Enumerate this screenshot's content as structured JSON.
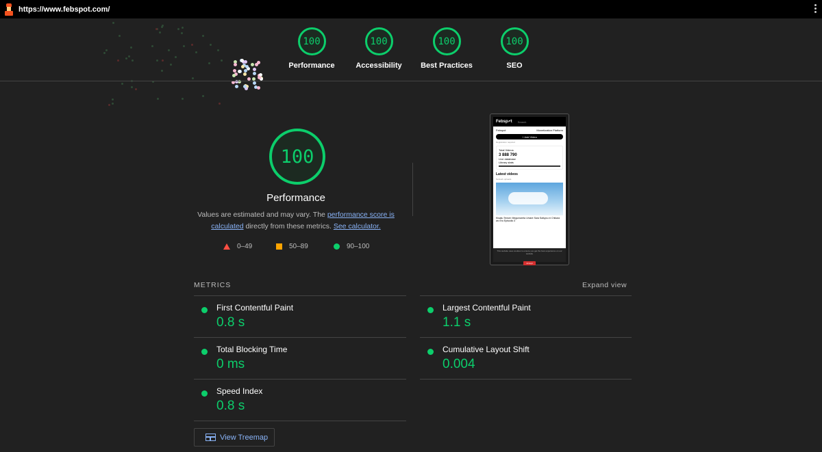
{
  "browser": {
    "url": "https://www.febspot.com/"
  },
  "gauges": [
    {
      "score": "100",
      "label": "Performance"
    },
    {
      "score": "100",
      "label": "Accessibility"
    },
    {
      "score": "100",
      "label": "Best Practices"
    },
    {
      "score": "100",
      "label": "SEO"
    }
  ],
  "performance": {
    "score": "100",
    "title": "Performance",
    "desc_pre": "Values are estimated and may vary. The ",
    "desc_link1": "performance score is calculated",
    "desc_mid": " directly from these metrics. ",
    "desc_link2": "See calculator.",
    "legend": [
      {
        "shape": "triangle",
        "range": "0–49",
        "color": "#ff4e42"
      },
      {
        "shape": "square",
        "range": "50–89",
        "color": "#ffa400"
      },
      {
        "shape": "circle",
        "range": "90–100",
        "color": "#0cce6b"
      }
    ]
  },
  "screenshot": {
    "brand": "Febsp🗲t",
    "search": "Search",
    "row_left": "Febspot",
    "row_right": "Monetization Platform",
    "add_button": "+ Add Video",
    "registration": "Registration required",
    "total_label": "Total Videos",
    "total_value": "3 888 790",
    "live": "Live database",
    "library_label": "Library stats",
    "latest": "Latest videos",
    "network": "Network uploads",
    "video_title": "Kisaku Tensei: Megumareta Umare Sara Saikyou ni Chikara wo Eru Episodio 3",
    "cookie_text": "This website uses cookies to ensure you get the best experience on our website",
    "accept": "Accept"
  },
  "metrics": {
    "label": "METRICS",
    "expand": "Expand view",
    "items": [
      {
        "name": "First Contentful Paint",
        "value": "0.8 s"
      },
      {
        "name": "Largest Contentful Paint",
        "value": "1.1 s"
      },
      {
        "name": "Total Blocking Time",
        "value": "0 ms"
      },
      {
        "name": "Cumulative Layout Shift",
        "value": "0.004"
      },
      {
        "name": "Speed Index",
        "value": "0.8 s"
      }
    ],
    "treemap_button": "View Treemap"
  },
  "colors": {
    "pass": "#0cce6b",
    "average": "#ffa400",
    "fail": "#ff4e42",
    "link": "#8ab4f8",
    "background": "#212121"
  }
}
